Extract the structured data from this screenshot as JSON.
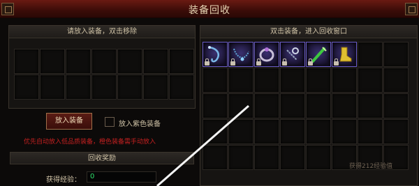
{
  "window": {
    "title": "装备回收"
  },
  "left_panel": {
    "header": "请放入装备，双击移除",
    "put_button": "放入装备",
    "purple_checkbox_label": "放入紫色装备",
    "hint": "优先自动放入低品质装备，橙色装备需手动放入"
  },
  "reward": {
    "header": "回收奖励",
    "exp_label": "获得经验：",
    "exp_value": "0"
  },
  "right_panel": {
    "header": "双击装备，进入回收窗口",
    "note": "获得212经验值",
    "items": [
      {
        "icon": "whip-item-icon",
        "color": "#7ab8e8"
      },
      {
        "icon": "chain-necklace-item-icon",
        "color": "#5fa8d8"
      },
      {
        "icon": "ring-item-icon",
        "color": "#b070d8"
      },
      {
        "icon": "bracelet-item-icon",
        "color": "#9aa8c0"
      },
      {
        "icon": "staff-item-icon",
        "color": "#3ec840"
      },
      {
        "icon": "boots-item-icon",
        "color": "#e0c030"
      }
    ]
  },
  "colors": {
    "accent": "#c42020",
    "exp_value": "#2ee06a",
    "item_border": "#6a5cc8"
  }
}
